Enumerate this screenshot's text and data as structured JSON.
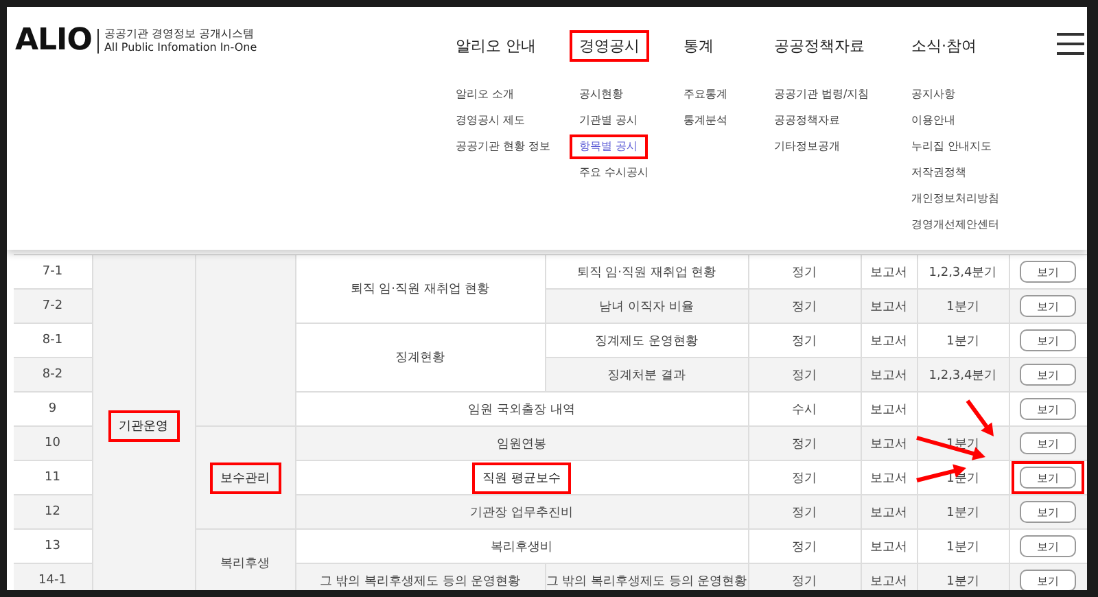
{
  "header": {
    "logo": "ALIO",
    "logo_title": "공공기관 경영정보 공개시스템",
    "logo_subtitle": "All Public Infomation In-One",
    "nav": [
      {
        "label": "알리오 안내",
        "highlighted": false,
        "items": [
          {
            "label": "알리오 소개",
            "selected": false,
            "highlighted": false
          },
          {
            "label": "경영공시 제도",
            "selected": false,
            "highlighted": false
          },
          {
            "label": "공공기관 현황 정보",
            "selected": false,
            "highlighted": false
          }
        ]
      },
      {
        "label": "경영공시",
        "highlighted": true,
        "items": [
          {
            "label": "공시현황",
            "selected": false,
            "highlighted": false
          },
          {
            "label": "기관별 공시",
            "selected": false,
            "highlighted": false
          },
          {
            "label": "항목별 공시",
            "selected": true,
            "highlighted": true
          },
          {
            "label": "주요 수시공시",
            "selected": false,
            "highlighted": false
          }
        ]
      },
      {
        "label": "통계",
        "highlighted": false,
        "items": [
          {
            "label": "주요통계",
            "selected": false,
            "highlighted": false
          },
          {
            "label": "통계분석",
            "selected": false,
            "highlighted": false
          }
        ]
      },
      {
        "label": "공공정책자료",
        "highlighted": false,
        "items": [
          {
            "label": "공공기관 법령/지침",
            "selected": false,
            "highlighted": false
          },
          {
            "label": "공공정책자료",
            "selected": false,
            "highlighted": false
          },
          {
            "label": "기타정보공개",
            "selected": false,
            "highlighted": false
          }
        ]
      },
      {
        "label": "소식·참여",
        "highlighted": false,
        "items": [
          {
            "label": "공지사항",
            "selected": false,
            "highlighted": false
          },
          {
            "label": "이용안내",
            "selected": false,
            "highlighted": false
          },
          {
            "label": "누리집 안내지도",
            "selected": false,
            "highlighted": false
          },
          {
            "label": "저작권정책",
            "selected": false,
            "highlighted": false
          },
          {
            "label": "개인정보처리방침",
            "selected": false,
            "highlighted": false
          },
          {
            "label": "경영개선제안센터",
            "selected": false,
            "highlighted": false
          }
        ]
      }
    ]
  },
  "table": {
    "sections": [
      {
        "category": "기관운영",
        "highlighted": true,
        "subsections": [
          {
            "items": [
              {
                "name": "퇴직 임·직원 재취업 현황",
                "highlighted": false,
                "rows": [
                  {
                    "no": "7-1",
                    "detail": "퇴직 임·직원 재취업 현황",
                    "type": "정기",
                    "form": "보고서",
                    "period": "1,2,3,4분기",
                    "button": "보기",
                    "highlighted": false
                  },
                  {
                    "no": "7-2",
                    "detail": "남녀 이직자 비율",
                    "type": "정기",
                    "form": "보고서",
                    "period": "1분기",
                    "button": "보기",
                    "highlighted": false
                  }
                ]
              },
              {
                "name": "징계현황",
                "highlighted": false,
                "rows": [
                  {
                    "no": "8-1",
                    "detail": "징계제도 운영현황",
                    "type": "정기",
                    "form": "보고서",
                    "period": "1분기",
                    "button": "보기",
                    "highlighted": false
                  },
                  {
                    "no": "8-2",
                    "detail": "징계처분 결과",
                    "type": "정기",
                    "form": "보고서",
                    "period": "1,2,3,4분기",
                    "button": "보기",
                    "highlighted": false
                  }
                ]
              },
              {
                "name": "임원 국외출장 내역",
                "highlighted": false,
                "rows": [
                  {
                    "no": "9",
                    "type": "수시",
                    "form": "보고서",
                    "button": "보기",
                    "highlighted": false
                  }
                ]
              }
            ]
          },
          {
            "category": "보수관리",
            "highlighted": true,
            "items": [
              {
                "name": "임원연봉",
                "highlighted": false,
                "rows": [
                  {
                    "no": "10",
                    "type": "정기",
                    "form": "보고서",
                    "period": "1분기",
                    "button": "보기",
                    "highlighted": false
                  }
                ]
              },
              {
                "name": "직원 평균보수",
                "highlighted": true,
                "rows": [
                  {
                    "no": "11",
                    "type": "정기",
                    "form": "보고서",
                    "period": "1분기",
                    "button": "보기",
                    "highlighted": true
                  }
                ]
              },
              {
                "name": "기관장 업무추진비",
                "highlighted": false,
                "rows": [
                  {
                    "no": "12",
                    "type": "정기",
                    "form": "보고서",
                    "period": "1분기",
                    "button": "보기",
                    "highlighted": false
                  }
                ]
              }
            ]
          },
          {
            "category": "복리후생",
            "highlighted": false,
            "items": [
              {
                "name": "복리후생비",
                "highlighted": false,
                "rows": [
                  {
                    "no": "13",
                    "type": "정기",
                    "form": "보고서",
                    "period": "1분기",
                    "button": "보기",
                    "highlighted": false
                  }
                ]
              },
              {
                "name": "그 밖의 복리후생제도 등의 운영현황",
                "highlighted": false,
                "rows": [
                  {
                    "no": "14-1",
                    "detail": "그 밖의 복리후생제도 등의 운영현황",
                    "type": "정기",
                    "form": "보고서",
                    "period": "1분기",
                    "button": "보기",
                    "highlighted": false
                  }
                ]
              }
            ]
          }
        ]
      }
    ]
  }
}
